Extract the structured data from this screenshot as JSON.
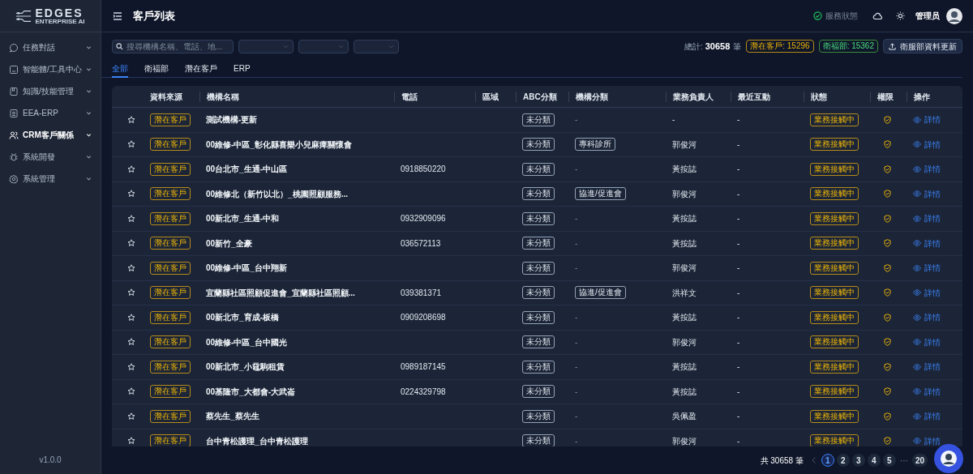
{
  "brand": {
    "name": "EDGES",
    "tagline": "ENTERPRISE AI"
  },
  "sidebar": {
    "items": [
      {
        "label": "任務對話",
        "selected": false
      },
      {
        "label": "智能體/工具中心",
        "selected": false
      },
      {
        "label": "知識/技能管理",
        "selected": false
      },
      {
        "label": "EEA-ERP",
        "selected": false
      },
      {
        "label": "CRM客戶關係",
        "selected": true
      },
      {
        "label": "系統開發",
        "selected": false
      },
      {
        "label": "系統管理",
        "selected": false
      }
    ],
    "version": "v1.0.0"
  },
  "header": {
    "title": "客戶列表",
    "service_status": "服務狀態",
    "user": "管理员"
  },
  "toolbar": {
    "search_placeholder": "搜尋機構名稱、電話、地...",
    "total_label": "總計:",
    "total": "30658",
    "total_unit": "筆",
    "potential_badge": "潛在客戶: 15296",
    "welfare_badge": "衛福部: 15362",
    "update_button": "衛服部資料更新"
  },
  "tabs": [
    {
      "label": "全部",
      "selected": true
    },
    {
      "label": "衛福部",
      "selected": false
    },
    {
      "label": "潛在客戶",
      "selected": false
    },
    {
      "label": "ERP",
      "selected": false
    }
  ],
  "table": {
    "columns": [
      "資料來源",
      "機構名稱",
      "電話",
      "區域",
      "ABC分類",
      "機構分類",
      "業務負責人",
      "最近互動",
      "狀態",
      "權限",
      "操作"
    ],
    "rows": [
      {
        "source": "潛在客戶",
        "name": "測試機構-更新",
        "abc": "未分類",
        "category": "-",
        "owner": "-",
        "recent": "-",
        "status": "業務接觸中",
        "action": "詳情"
      },
      {
        "source": "潛在客戶",
        "name": "00維修-中區_彰化縣喜樂小兒麻痺關懷會",
        "abc": "未分類",
        "category": "專科診所",
        "owner": "郭俊河",
        "recent": "-",
        "status": "業務接觸中",
        "action": "詳情"
      },
      {
        "source": "潛在客戶",
        "name": "00台北市_生通-中山區",
        "phone": "0918850220",
        "abc": "未分類",
        "category": "-",
        "owner": "黃按誌",
        "recent": "-",
        "status": "業務接觸中",
        "action": "詳情"
      },
      {
        "source": "潛在客戶",
        "name": "00維修北（新竹以北）_桃園照顧服務...",
        "abc": "未分類",
        "category": "協進/促進會",
        "owner": "郭俊河",
        "recent": "-",
        "status": "業務接觸中",
        "action": "詳情"
      },
      {
        "source": "潛在客戶",
        "name": "00新北市_生通-中和",
        "phone": "0932909096",
        "abc": "未分類",
        "category": "-",
        "owner": "黃按誌",
        "recent": "-",
        "status": "業務接觸中",
        "action": "詳情"
      },
      {
        "source": "潛在客戶",
        "name": "00新竹_全豪",
        "phone": "036572113",
        "abc": "未分類",
        "category": "-",
        "owner": "黃按誌",
        "recent": "-",
        "status": "業務接觸中",
        "action": "詳情"
      },
      {
        "source": "潛在客戶",
        "name": "00維修-中區_台中翔新",
        "abc": "未分類",
        "category": "-",
        "owner": "郭俊河",
        "recent": "-",
        "status": "業務接觸中",
        "action": "詳情"
      },
      {
        "source": "潛在客戶",
        "name": "宜蘭縣社區照顧促進會_宜蘭縣社區照顧...",
        "phone": "039381371",
        "abc": "未分類",
        "category": "協進/促進會",
        "owner": "洪祥文",
        "recent": "-",
        "status": "業務接觸中",
        "action": "詳情"
      },
      {
        "source": "潛在客戶",
        "name": "00新北市_育成-板橋",
        "phone": "0909208698",
        "abc": "未分類",
        "category": "-",
        "owner": "黃按誌",
        "recent": "-",
        "status": "業務接觸中",
        "action": "詳情"
      },
      {
        "source": "潛在客戶",
        "name": "00維修-中區_台中國光",
        "abc": "未分類",
        "category": "-",
        "owner": "郭俊河",
        "recent": "-",
        "status": "業務接觸中",
        "action": "詳情"
      },
      {
        "source": "潛在客戶",
        "name": "00新北市_小黿駒租賃",
        "phone": "0989187145",
        "abc": "未分類",
        "category": "-",
        "owner": "黃按誌",
        "recent": "-",
        "status": "業務接觸中",
        "action": "詳情"
      },
      {
        "source": "潛在客戶",
        "name": "00基隆市_大都會-大武崙",
        "phone": "0224329798",
        "abc": "未分類",
        "category": "-",
        "owner": "黃按誌",
        "recent": "-",
        "status": "業務接觸中",
        "action": "詳情"
      },
      {
        "source": "潛在客戶",
        "name": "蔡先生_蔡先生",
        "abc": "未分類",
        "category": "-",
        "owner": "吳佩盈",
        "recent": "-",
        "status": "業務接觸中",
        "action": "詳情"
      },
      {
        "source": "潛在客戶",
        "name": "台中青松護理_台中青松護理",
        "abc": "未分類",
        "category": "-",
        "owner": "郭俊河",
        "recent": "-",
        "status": "業務接觸中",
        "action": "詳情"
      }
    ]
  },
  "pagination": {
    "total": "共 30658 筆",
    "pages": [
      {
        "label": "1",
        "selected": true
      },
      {
        "label": "2",
        "selected": false
      },
      {
        "label": "3",
        "selected": false
      },
      {
        "label": "4",
        "selected": false
      },
      {
        "label": "5",
        "selected": false
      },
      {
        "label": "···",
        "kind": "ellipsis"
      },
      {
        "label": "20",
        "selected": false
      }
    ]
  }
}
